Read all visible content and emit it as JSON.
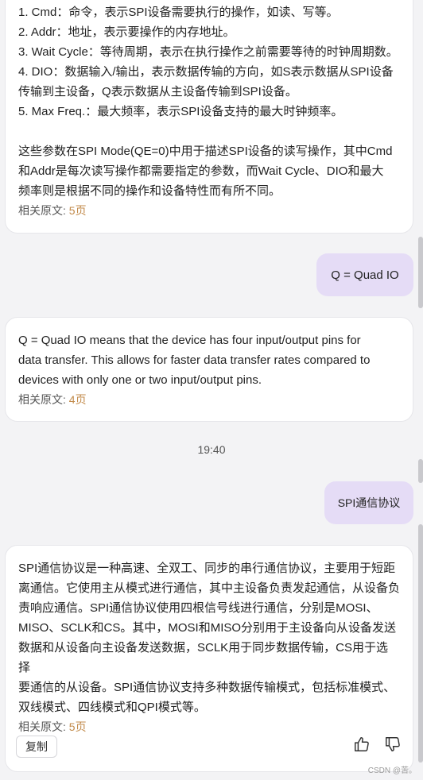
{
  "msg1": {
    "lines": [
      "1. Cmd：命令，表示SPI设备需要执行的操作，如读、写等。",
      "2. Addr：地址，表示要操作的内存地址。",
      "3. Wait Cycle：等待周期，表示在执行操作之前需要等待的时钟周期数。",
      "4. DIO：数据输入/输出，表示数据传输的方向，如S表示数据从SPI设备",
      "传输到主设备，Q表示数据从主设备传输到SPI设备。",
      "5. Max Freq.：最大频率，表示SPI设备支持的最大时钟频率。"
    ],
    "para": [
      "这些参数在SPI Mode(QE=0)中用于描述SPI设备的读写操作，其中Cmd",
      "和Addr是每次读写操作都需要指定的参数，而Wait Cycle、DIO和最大",
      "频率则是根据不同的操作和设备特性而有所不同。"
    ],
    "ref_label": "相关原文: ",
    "ref_page": "5页"
  },
  "user1": "Q = Quad IO",
  "msg2": {
    "lines": [
      "Q = Quad IO means that the device has four input/output pins for",
      "data transfer. This allows for faster data transfer rates compared to",
      "devices with only one or two input/output pins."
    ],
    "ref_label": "相关原文: ",
    "ref_page": "4页"
  },
  "timestamp": "19:40",
  "user2": "SPI通信协议",
  "msg3": {
    "lines": [
      "SPI通信协议是一种高速、全双工、同步的串行通信协议，主要用于短距",
      "离通信。它使用主从模式进行通信，其中主设备负责发起通信，从设备负",
      "责响应通信。SPI通信协议使用四根信号线进行通信，分别是MOSI、",
      "MISO、SCLK和CS。其中，MOSI和MISO分别用于主设备向从设备发送",
      "数据和从设备向主设备发送数据，SCLK用于同步数据传输，CS用于选择",
      "要通信的从设备。SPI通信协议支持多种数据传输模式，包括标准模式、",
      "双线模式、四线模式和QPI模式等。"
    ],
    "ref_label": "相关原文: ",
    "ref_page": "5页"
  },
  "copy_label": "复制",
  "icons": {
    "like": "thumbs-up-icon",
    "dislike": "thumbs-down-icon"
  },
  "watermark": "CSDN @苦。",
  "colors": {
    "user_bubble": "#e5dcf6",
    "ref_page": "#c28a4a",
    "background": "#f3f3f5"
  }
}
